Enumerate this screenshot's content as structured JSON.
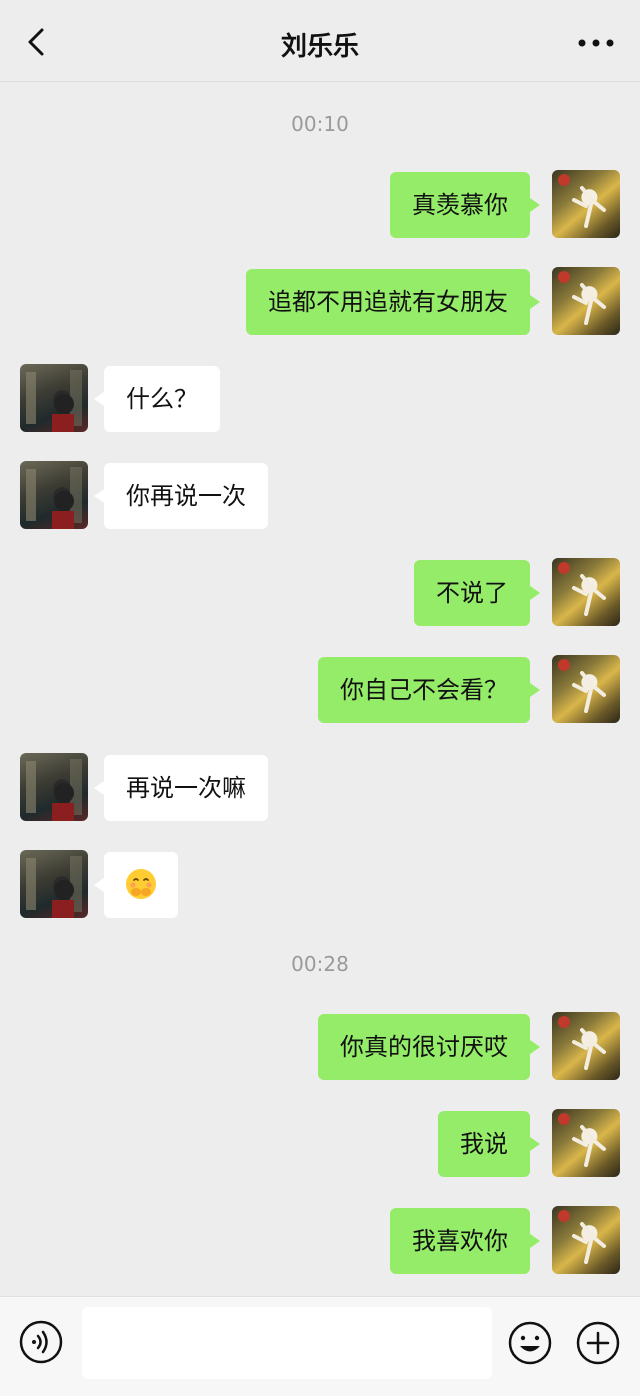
{
  "header": {
    "title": "刘乐乐",
    "back_icon": "chevron-left-icon",
    "more_icon": "more-dots-icon"
  },
  "timestamps": [
    "00:10",
    "00:28"
  ],
  "messages": [
    {
      "side": "out",
      "text": "真羡慕你"
    },
    {
      "side": "out",
      "text": "追都不用追就有女朋友"
    },
    {
      "side": "in",
      "text": "什么？"
    },
    {
      "side": "in",
      "text": "你再说一次"
    },
    {
      "side": "out",
      "text": "不说了"
    },
    {
      "side": "out",
      "text": "你自己不会看？"
    },
    {
      "side": "in",
      "text": "再说一次嘛"
    },
    {
      "side": "in",
      "emoji": "shy-hug-emoji"
    },
    {
      "side": "out",
      "text": "你真的很讨厌哎"
    },
    {
      "side": "out",
      "text": "我说"
    },
    {
      "side": "out",
      "text": "我喜欢你"
    }
  ],
  "input": {
    "value": "",
    "placeholder": ""
  },
  "colors": {
    "outgoing_bubble": "#95ec69",
    "incoming_bubble": "#ffffff",
    "background": "#ededed",
    "timestamp": "#9a9a9a"
  }
}
